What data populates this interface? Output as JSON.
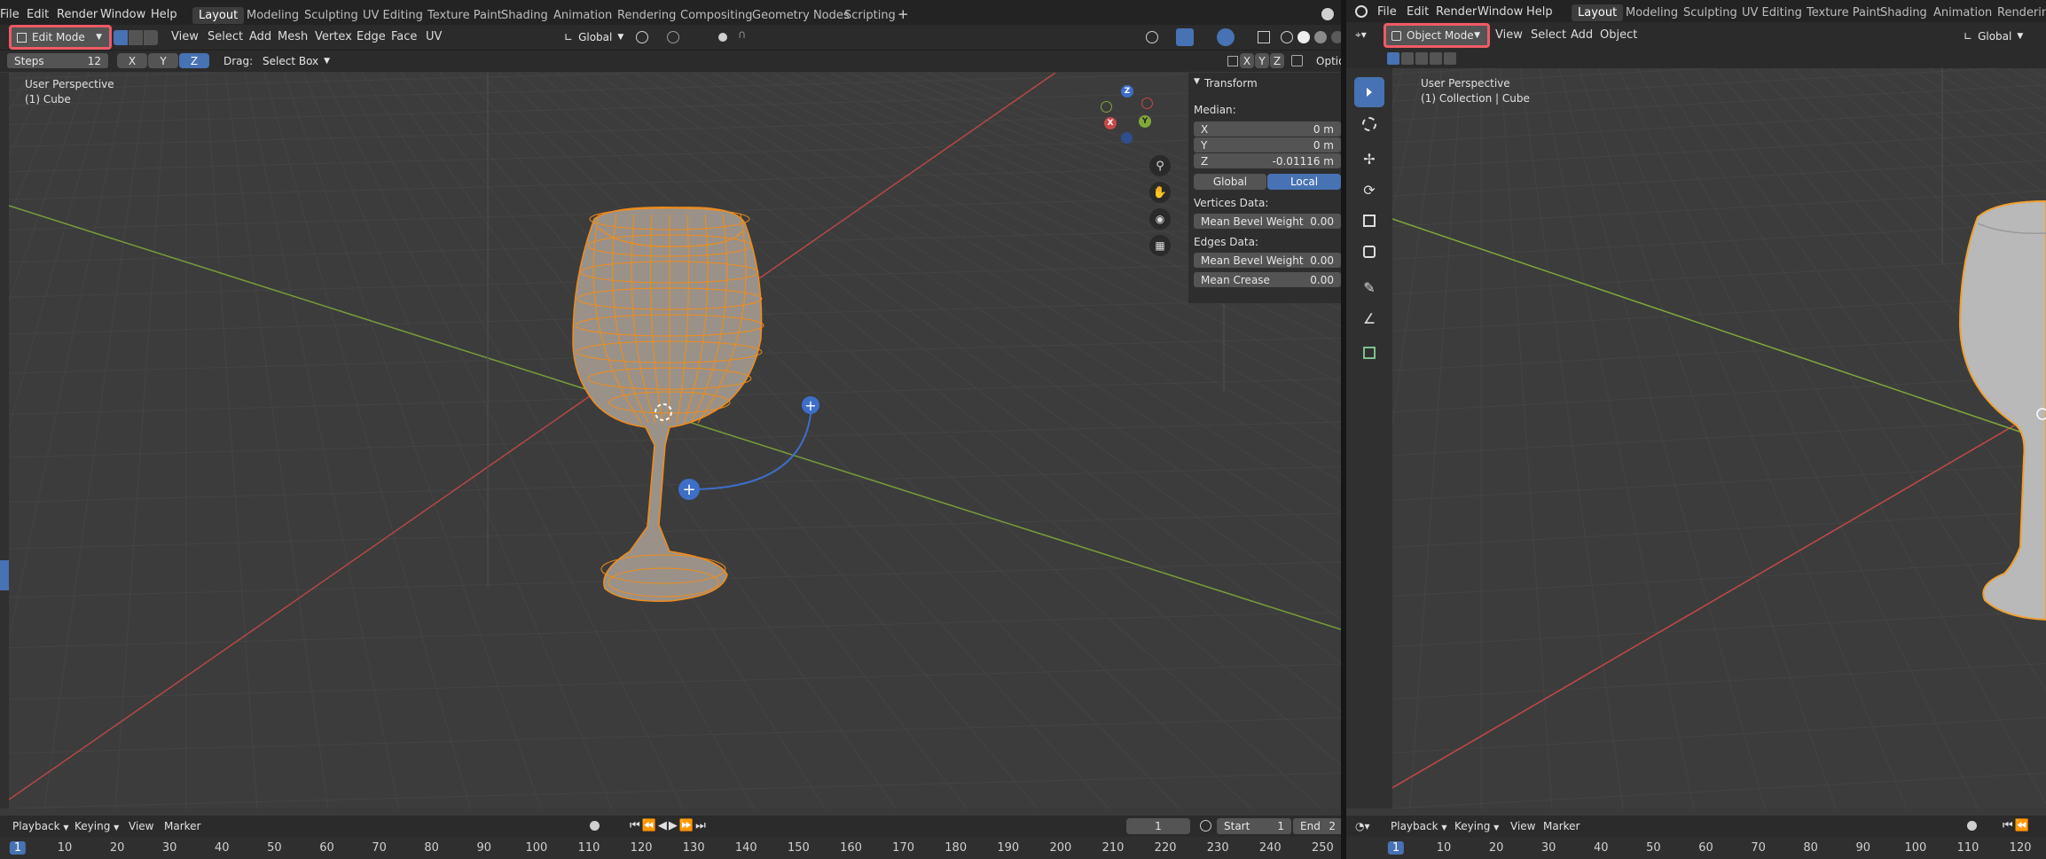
{
  "left": {
    "topbar": {
      "menus": [
        "File",
        "Edit",
        "Render",
        "Window",
        "Help"
      ],
      "workspaces": [
        "Layout",
        "Modeling",
        "Sculpting",
        "UV Editing",
        "Texture Paint",
        "Shading",
        "Animation",
        "Rendering",
        "Compositing",
        "Geometry Nodes",
        "Scripting"
      ],
      "add_tab": "+"
    },
    "header": {
      "mode": "Edit Mode",
      "menus": [
        "View",
        "Select",
        "Add",
        "Mesh",
        "Vertex",
        "Edge",
        "Face",
        "UV"
      ],
      "orientation": "Global"
    },
    "tool_settings": {
      "steps_label": "Steps",
      "steps_value": "12",
      "axes": [
        "X",
        "Y",
        "Z"
      ],
      "drag_label": "Drag:",
      "drag_value": "Select Box",
      "options_label": "Optio",
      "mirror_axes": [
        "X",
        "Y",
        "Z"
      ]
    },
    "viewport": {
      "perspective": "User Perspective",
      "object": "(1) Cube"
    },
    "gizmo": {
      "x": "X",
      "y": "Y",
      "z": "Z"
    },
    "transform_panel": {
      "title": "Transform",
      "median_label": "Median:",
      "fields": [
        {
          "label": "X",
          "value": "0 m"
        },
        {
          "label": "Y",
          "value": "0 m"
        },
        {
          "label": "Z",
          "value": "-0.01116 m"
        }
      ],
      "space": [
        "Global",
        "Local"
      ],
      "vertices_label": "Vertices Data:",
      "vertex_fields": [
        {
          "label": "Mean Bevel Weight",
          "value": "0.00"
        }
      ],
      "edges_label": "Edges Data:",
      "edge_fields": [
        {
          "label": "Mean Bevel Weight",
          "value": "0.00"
        },
        {
          "label": "Mean Crease",
          "value": "0.00"
        }
      ]
    },
    "timeline": {
      "menus": [
        "Playback",
        "Keying",
        "View",
        "Marker"
      ],
      "current_frame": "1",
      "start_label": "Start",
      "start_value": "1",
      "end_label": "End",
      "end_value": "2",
      "ticks": [
        "1",
        "10",
        "20",
        "30",
        "40",
        "50",
        "60",
        "70",
        "80",
        "90",
        "100",
        "110",
        "120",
        "130",
        "140",
        "150",
        "160",
        "170",
        "180",
        "190",
        "200",
        "210",
        "220",
        "230",
        "240",
        "250"
      ]
    }
  },
  "right": {
    "topbar": {
      "menus": [
        "File",
        "Edit",
        "Render",
        "Window",
        "Help"
      ],
      "workspaces": [
        "Layout",
        "Modeling",
        "Sculpting",
        "UV Editing",
        "Texture Paint",
        "Shading",
        "Animation",
        "Renderin"
      ]
    },
    "header": {
      "mode": "Object Mode",
      "menus": [
        "View",
        "Select",
        "Add",
        "Object"
      ],
      "orientation": "Global"
    },
    "viewport": {
      "perspective": "User Perspective",
      "object": "(1) Collection | Cube"
    },
    "timeline": {
      "menus": [
        "Playback",
        "Keying",
        "View",
        "Marker"
      ],
      "ticks": [
        "1",
        "10",
        "20",
        "30",
        "40",
        "50",
        "60",
        "70",
        "80",
        "90",
        "100",
        "110",
        "120"
      ]
    }
  },
  "colors": {
    "accent": "#4772b3",
    "highlight": "#f05a65",
    "selection": "#f28c1a",
    "axis_x": "#c64848",
    "axis_y": "#7fa839",
    "axis_z": "#3d6ec8"
  }
}
